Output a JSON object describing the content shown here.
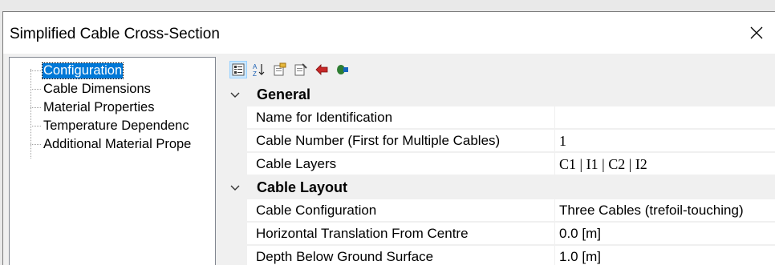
{
  "window": {
    "title": "Simplified Cable Cross-Section"
  },
  "tree": {
    "items": [
      {
        "label": "Configuration",
        "selected": true
      },
      {
        "label": "Cable Dimensions",
        "selected": false
      },
      {
        "label": "Material Properties",
        "selected": false
      },
      {
        "label": "Temperature Dependenc",
        "selected": false
      },
      {
        "label": "Additional Material Prope",
        "selected": false
      }
    ]
  },
  "toolbar": {
    "buttons": [
      "categorized-view-icon",
      "alphabetical-sort-icon",
      "property-pages-icon",
      "edit-page-icon",
      "red-arrow-icon",
      "green-arrow-icon"
    ]
  },
  "grid": {
    "categories": [
      {
        "label": "General",
        "properties": [
          {
            "name": "Name for Identification",
            "value": ""
          },
          {
            "name": "Cable Number (First for Multiple Cables)",
            "value": "1"
          },
          {
            "name": "Cable Layers",
            "value": "C1 | I1 | C2 | I2"
          }
        ]
      },
      {
        "label": "Cable Layout",
        "properties": [
          {
            "name": "Cable Configuration",
            "value": "Three Cables (trefoil-touching)"
          },
          {
            "name": "Horizontal Translation From Centre",
            "value": "0.0 [m]"
          },
          {
            "name": "Depth Below Ground Surface",
            "value": "1.0 [m]"
          }
        ]
      }
    ]
  },
  "colors": {
    "selection": "#0078d7",
    "chrome": "#f0f0f0",
    "border": "#828790"
  }
}
